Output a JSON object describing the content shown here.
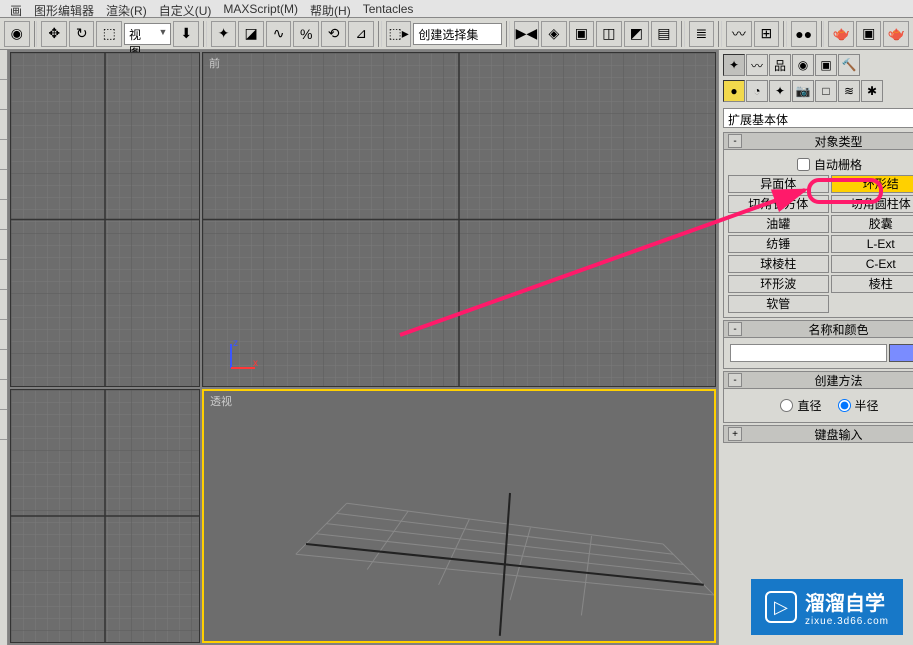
{
  "menu": {
    "items": [
      "画",
      "图形编辑器",
      "渲染(R)",
      "自定义(U)",
      "MAXScript(M)",
      "帮助(H)",
      "Tentacles"
    ]
  },
  "toolbar": {
    "view_dropdown": "视图",
    "selection_set": "创建选择集"
  },
  "viewports": {
    "top_left": "",
    "top_right": "前",
    "bottom_left": "",
    "bottom_right": "透视",
    "axis_z": "z",
    "axis_x": "x"
  },
  "panel": {
    "category_dropdown": "扩展基本体",
    "rollout_object_type": "对象类型",
    "auto_grid": "自动栅格",
    "buttons": [
      [
        "异面体",
        "环形结"
      ],
      [
        "切角长方体",
        "切角圆柱体"
      ],
      [
        "油罐",
        "胶囊"
      ],
      [
        "纺锤",
        "L-Ext"
      ],
      [
        "球棱柱",
        "C-Ext"
      ],
      [
        "环形波",
        "棱柱"
      ],
      [
        "软管",
        ""
      ]
    ],
    "rollout_name_color": "名称和颜色",
    "name_value": "",
    "rollout_create_method": "创建方法",
    "radio_diameter": "直径",
    "radio_radius": "半径",
    "rollout_keyboard": "键盘输入",
    "plus": "+",
    "minus": "-"
  },
  "watermark": {
    "brand": "溜溜自学",
    "url": "zixue.3d66.com"
  }
}
